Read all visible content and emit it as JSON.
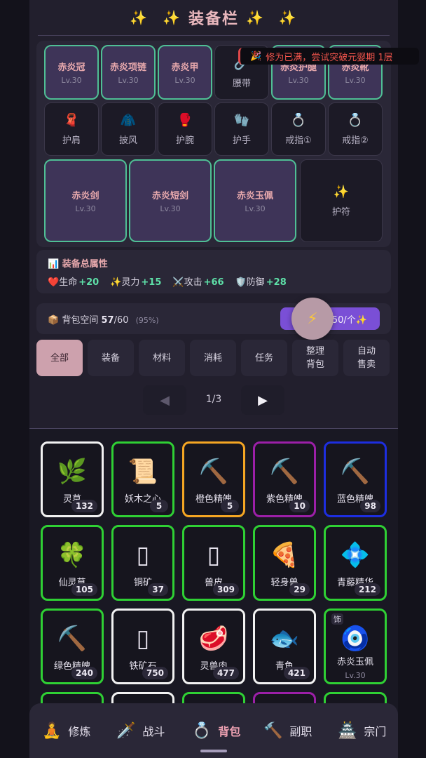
{
  "title": {
    "text": "装备栏",
    "sparkle": "✨"
  },
  "tip": {
    "icon": "🎉",
    "text": "修为已满，尝试突破元婴期 1层"
  },
  "equip_slots": [
    {
      "name": "赤炎冠",
      "level": "Lv.30"
    },
    {
      "name": "赤炎项链",
      "level": "Lv.30"
    },
    {
      "name": "赤炎甲",
      "level": "Lv.30"
    },
    {
      "label": "腰带",
      "icon": "🔗"
    },
    {
      "name": "赤炎护腿",
      "level": "Lv.30"
    },
    {
      "name": "赤炎靴",
      "level": "Lv.30"
    },
    {
      "label": "护肩",
      "icon": "🧣"
    },
    {
      "label": "披风",
      "icon": "🧥"
    },
    {
      "label": "护腕",
      "icon": "🥊"
    },
    {
      "label": "护手",
      "icon": "🧤"
    },
    {
      "label": "戒指①",
      "icon": "💍"
    },
    {
      "label": "戒指②",
      "icon": "💍"
    },
    {
      "name": "赤炎剑",
      "level": "Lv.30"
    },
    {
      "name": "赤炎短剑",
      "level": "Lv.30"
    },
    {
      "name": "赤炎玉佩",
      "level": "Lv.30"
    },
    {
      "label": "护符",
      "icon": "✨"
    }
  ],
  "stats": {
    "header_icon": "📊",
    "header": "装备总属性",
    "items": [
      {
        "icon": "❤️",
        "label": "生命",
        "value": "+20"
      },
      {
        "icon": "✨",
        "label": "灵力",
        "value": "+15"
      },
      {
        "icon": "⚔️",
        "label": "攻击",
        "value": "+66"
      },
      {
        "icon": "🛡️",
        "label": "防御",
        "value": "+28"
      }
    ]
  },
  "bag": {
    "icon": "📦",
    "label": "背包空间",
    "used": "57",
    "total": "/60",
    "percent": "(95%)",
    "expand_label": "50/个✨",
    "fab_icon": "⚡"
  },
  "tabs": [
    {
      "label": "全部",
      "active": true
    },
    {
      "label": "装备"
    },
    {
      "label": "材料"
    },
    {
      "label": "消耗"
    },
    {
      "label": "任务"
    },
    {
      "label": "整理\n背包"
    },
    {
      "label": "自动\n售卖"
    }
  ],
  "pager": {
    "prev": "◀",
    "next": "▶",
    "text": "1/3"
  },
  "items": [
    {
      "name": "灵草",
      "qty": "132",
      "icon": "🌿",
      "border": "#f2f2f2"
    },
    {
      "name": "妖木之心",
      "qty": "5",
      "icon": "📜",
      "border": "#2fd034"
    },
    {
      "name": "橙色精魄",
      "qty": "5",
      "icon": "⛏️",
      "border": "#f5a623"
    },
    {
      "name": "紫色精魄",
      "qty": "10",
      "icon": "⛏️",
      "border": "#9c1fa8"
    },
    {
      "name": "蓝色精魄",
      "qty": "98",
      "icon": "⛏️",
      "border": "#1d2ee0"
    },
    {
      "name": "仙灵草",
      "qty": "105",
      "icon": "🍀",
      "border": "#2fd034"
    },
    {
      "name": "铜矿",
      "qty": "37",
      "icon": "▯",
      "border": "#2fd034"
    },
    {
      "name": "兽皮",
      "qty": "309",
      "icon": "▯",
      "border": "#2fd034"
    },
    {
      "name": "轻身兽",
      "qty": "29",
      "icon": "🍕",
      "border": "#2fd034"
    },
    {
      "name": "青藤精华",
      "qty": "212",
      "icon": "💠",
      "border": "#2fd034"
    },
    {
      "name": "绿色精魄",
      "qty": "240",
      "icon": "⛏️",
      "border": "#2fd034"
    },
    {
      "name": "铁矿石",
      "qty": "750",
      "icon": "▯",
      "border": "#f2f2f2"
    },
    {
      "name": "灵兽肉",
      "qty": "477",
      "icon": "🥩",
      "border": "#f2f2f2"
    },
    {
      "name": "青鱼",
      "qty": "421",
      "icon": "🐟",
      "border": "#f2f2f2"
    },
    {
      "name": "赤炎玉佩",
      "level": "Lv.30",
      "tag": "饰",
      "icon": "🧿",
      "border": "#2fd034"
    }
  ],
  "nav": [
    {
      "label": "修炼",
      "icon": "🧘"
    },
    {
      "label": "战斗",
      "icon": "🗡️"
    },
    {
      "label": "背包",
      "icon": "💍",
      "active": true
    },
    {
      "label": "副职",
      "icon": "🔨"
    },
    {
      "label": "宗门",
      "icon": "🏯"
    }
  ]
}
